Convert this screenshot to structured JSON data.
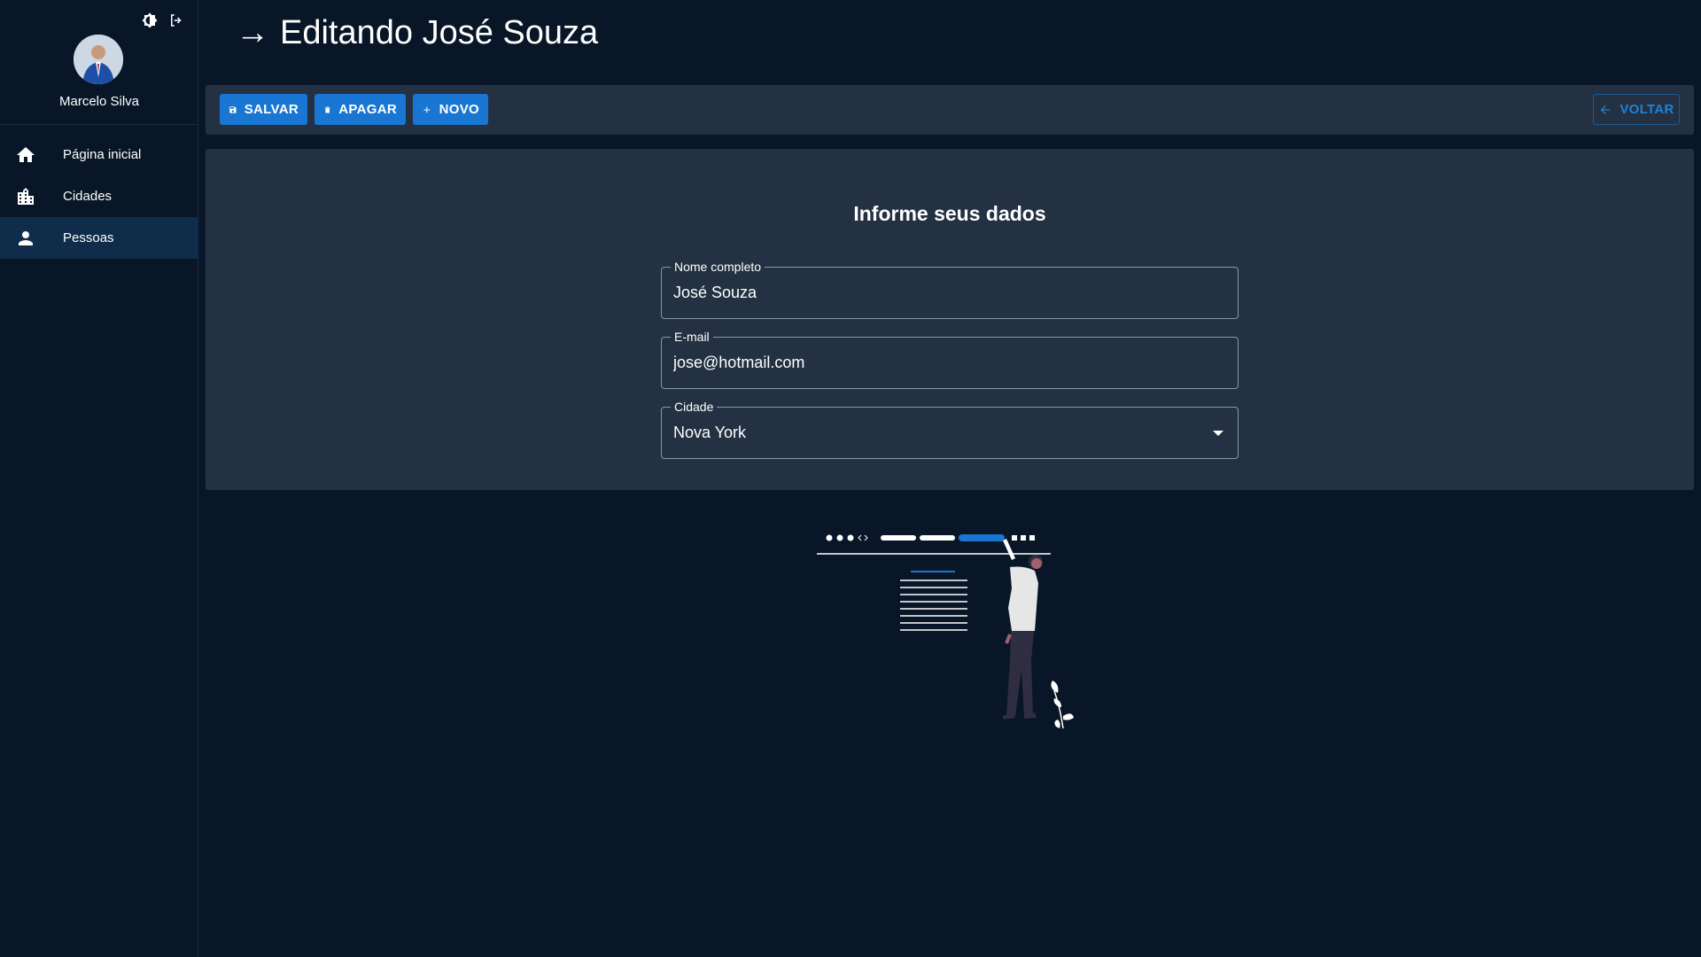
{
  "sidebar": {
    "user_name": "Marcelo Silva",
    "top_icons": [
      "theme-toggle-icon",
      "logout-icon"
    ],
    "items": [
      {
        "label": "Página inicial",
        "icon": "home-icon"
      },
      {
        "label": "Cidades",
        "icon": "city-icon"
      },
      {
        "label": "Pessoas",
        "icon": "person-icon",
        "active": true
      }
    ]
  },
  "header": {
    "arrow": "→",
    "title": "Editando José Souza"
  },
  "toolbar": {
    "save_label": "SALVAR",
    "delete_label": "APAGAR",
    "new_label": "NOVO",
    "back_label": "VOLTAR"
  },
  "form": {
    "title": "Informe seus dados",
    "name_label": "Nome completo",
    "name_value": "José Souza",
    "email_label": "E-mail",
    "email_value": "jose@hotmail.com",
    "city_label": "Cidade",
    "city_value": "Nova York"
  },
  "colors": {
    "background": "#081627",
    "panel": "#233142",
    "primary": "#1976d2",
    "active_nav": "#0f2c4a"
  }
}
